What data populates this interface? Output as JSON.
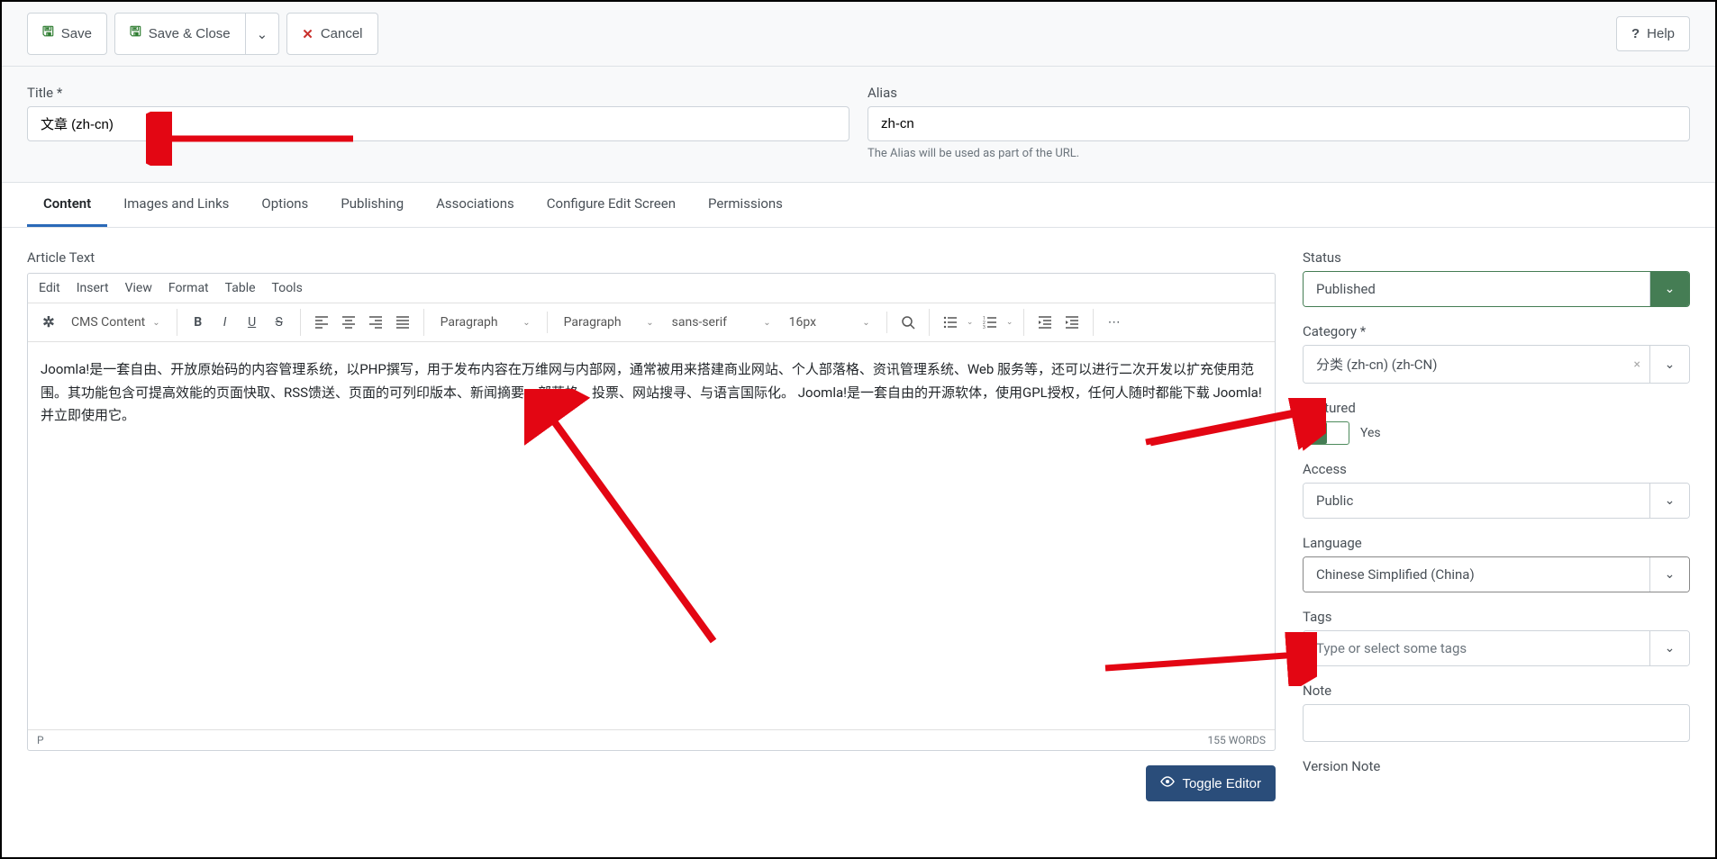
{
  "toolbar": {
    "save": "Save",
    "save_close": "Save & Close",
    "cancel": "Cancel",
    "help": "Help"
  },
  "header": {
    "title_label": "Title *",
    "title_value": "文章 (zh-cn)",
    "alias_label": "Alias",
    "alias_value": "zh-cn",
    "alias_help": "The Alias will be used as part of the URL."
  },
  "tabs": [
    "Content",
    "Images and Links",
    "Options",
    "Publishing",
    "Associations",
    "Configure Edit Screen",
    "Permissions"
  ],
  "editor": {
    "label": "Article Text",
    "menus": [
      "Edit",
      "Insert",
      "View",
      "Format",
      "Table",
      "Tools"
    ],
    "cms_content": "CMS Content",
    "format_select1": "Paragraph",
    "format_select2": "Paragraph",
    "font_family": "sans-serif",
    "font_size": "16px",
    "body": "Joomla!是一套自由、开放原始码的内容管理系统，以PHP撰写，用于发布内容在万维网与内部网，通常被用来搭建商业网站、个人部落格、资讯管理系统、Web 服务等，还可以进行二次开发以扩充使用范围。其功能包含可提高效能的页面快取、RSS馈送、页面的可列印版本、新闻摘要、部落格、投票、网站搜寻、与语言国际化。 Joomla!是一套自由的开源软体，使用GPL授权，任何人随时都能下载 Joomla! 并立即使用它。",
    "path": "P",
    "word_count": "155 WORDS",
    "toggle": "Toggle Editor"
  },
  "sidebar": {
    "status_label": "Status",
    "status_value": "Published",
    "category_label": "Category *",
    "category_value": "分类 (zh-cn) (zh-CN)",
    "featured_label": "Featured",
    "featured_value": "Yes",
    "access_label": "Access",
    "access_value": "Public",
    "language_label": "Language",
    "language_value": "Chinese Simplified (China)",
    "tags_label": "Tags",
    "tags_placeholder": "Type or select some tags",
    "note_label": "Note",
    "version_note_label": "Version Note"
  }
}
